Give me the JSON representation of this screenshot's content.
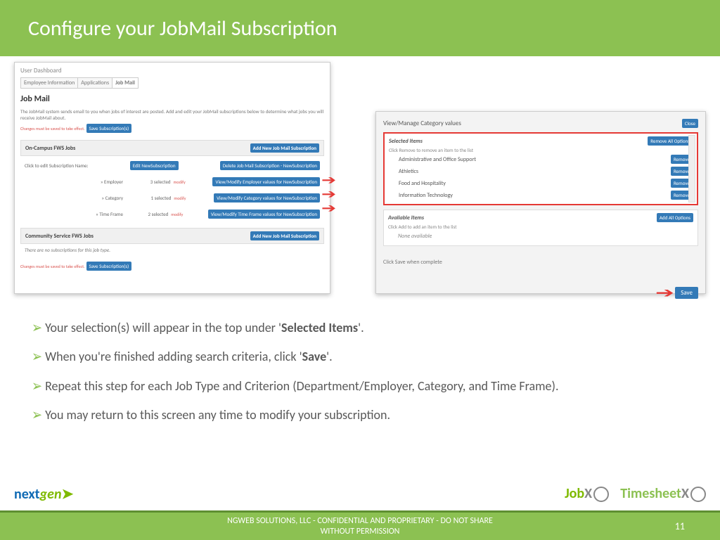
{
  "slide": {
    "title": "Configure your JobMail Subscription",
    "page_number": "11",
    "footer": "NGWEB SOLUTIONS, LLC - CONFIDENTIAL AND  PROPRIETARY - DO NOT SHARE WITHOUT PERMISSION"
  },
  "bullets": [
    {
      "pre": "Your selection(s) will appear in the top under '",
      "bold": "Selected Items",
      "post": "'."
    },
    {
      "pre": "When you're finished adding search criteria, click '",
      "bold": "Save",
      "post": "'."
    },
    {
      "pre": "Repeat this step for each Job Type and Criterion (Department/Employer, Category, and Time Frame).",
      "bold": "",
      "post": ""
    },
    {
      "pre": "You may return to this screen any time to modify your subscription.",
      "bold": "",
      "post": ""
    }
  ],
  "left": {
    "dash": "User Dashboard",
    "tabs": [
      "Employee Information",
      "Applications",
      "Job Mail"
    ],
    "heading": "Job Mail",
    "intro": "The JobMail system sends email to you when jobs of interest are posted. Add and edit your JobMail subscriptions below to determine what jobs you will receive JobMail about.",
    "warn": "Changes must be saved to take effect.",
    "save_btn": "Save Subscription(s)",
    "type1": "On-Campus FWS Jobs",
    "add_btn": "Add New Job Mail Subscription",
    "edit_label": "Click to edit Subscription Name:",
    "edit_btn": "Edit NewSubscription",
    "delete_btn": "Delete Job Mail Subscription - NewSubscription",
    "rows": [
      {
        "label": "» Employer",
        "count": "3 selected",
        "mod": "modify",
        "btn": "View/Modify Employer values for NewSubscription"
      },
      {
        "label": "» Category",
        "count": "1 selected",
        "mod": "modify",
        "btn": "View/Modify Category values for NewSubscription"
      },
      {
        "label": "» Time Frame",
        "count": "2 selected",
        "mod": "modify",
        "btn": "View/Modify Time Frame values for NewSubscription"
      }
    ],
    "type2": "Community Service FWS Jobs",
    "none_msg": "There are no subscriptions for this job type."
  },
  "right": {
    "heading": "View/Manage Category values",
    "close": "Close",
    "sel_head": "Selected Items",
    "remove_all": "Remove All Options",
    "sel_hint": "Click Remove to remove an item to the list",
    "items": [
      "Administrative and Office Support",
      "Athletics",
      "Food and Hospitality",
      "Information Technology"
    ],
    "remove": "Remove",
    "avail_head": "Available Items",
    "add_all": "Add All Options",
    "avail_hint": "Click Add to add an item to the list",
    "none": "None available",
    "save_hint": "Click Save when complete",
    "save": "Save"
  },
  "logos": {
    "nextgen_a": "next",
    "nextgen_b": "gen",
    "jobx_a": "Job",
    "jobx_b": "X",
    "tsx_a": "Timesheet",
    "tsx_b": "X"
  }
}
